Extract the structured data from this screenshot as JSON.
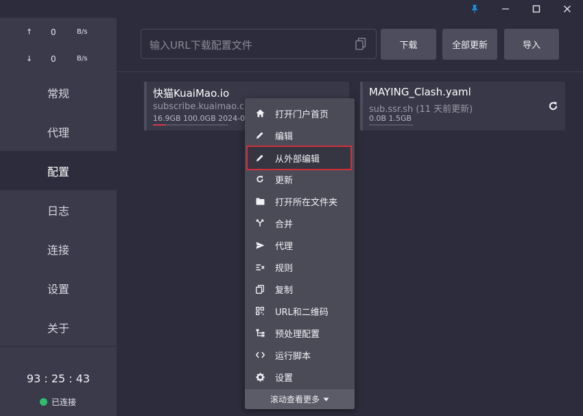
{
  "window": {
    "pin_icon": "pin-icon",
    "minimize_icon": "minimize-icon",
    "maximize_icon": "maximize-icon",
    "close_icon": "close-icon",
    "accent": "#1d8fd8"
  },
  "traffic": {
    "upload": {
      "arrow": "↑",
      "value": "0",
      "unit": "B/s"
    },
    "download": {
      "arrow": "↓",
      "value": "0",
      "unit": "B/s"
    }
  },
  "nav": {
    "general": "常规",
    "proxies": "代理",
    "profiles": "配置",
    "logs": "日志",
    "connections": "连接",
    "settings": "设置",
    "about": "关于"
  },
  "footer": {
    "uptime": "93 : 25 : 43",
    "status": "已连接",
    "status_color": "#2dbf6c"
  },
  "toolbar": {
    "url_placeholder": "输入URL下载配置文件",
    "download": "下载",
    "update_all": "全部更新",
    "import": "导入"
  },
  "profiles": [
    {
      "name": "快猫KuaiMao.io",
      "source": "subscribe.kuaimao.cl…",
      "usage": "16.9GB   100.0GB   2024-0…",
      "usage_fraction": 0.169
    },
    {
      "name": "MAYING_Clash.yaml",
      "source": "sub.ssr.sh (11 天前更新)",
      "usage": "0.0B   1.5GB",
      "usage_fraction": 0.0
    }
  ],
  "context_menu": {
    "items": [
      {
        "label": "打开门户首页",
        "icon": "home-icon"
      },
      {
        "label": "编辑",
        "icon": "pencil-icon"
      },
      {
        "label": "从外部编辑",
        "icon": "pencil-icon"
      },
      {
        "label": "更新",
        "icon": "refresh-icon"
      },
      {
        "label": "打开所在文件夹",
        "icon": "folder-icon"
      },
      {
        "label": "合并",
        "icon": "merge-icon"
      },
      {
        "label": "代理",
        "icon": "send-icon"
      },
      {
        "label": "规则",
        "icon": "rules-icon"
      },
      {
        "label": "复制",
        "icon": "copy-icon"
      },
      {
        "label": "URL和二维码",
        "icon": "qrcode-icon"
      },
      {
        "label": "预处理配置",
        "icon": "tree-icon"
      },
      {
        "label": "运行脚本",
        "icon": "code-icon"
      },
      {
        "label": "设置",
        "icon": "gear-icon"
      }
    ],
    "highlighted": "从外部编辑",
    "highlight_color": "#d0303c",
    "more": "滚动查看更多"
  }
}
